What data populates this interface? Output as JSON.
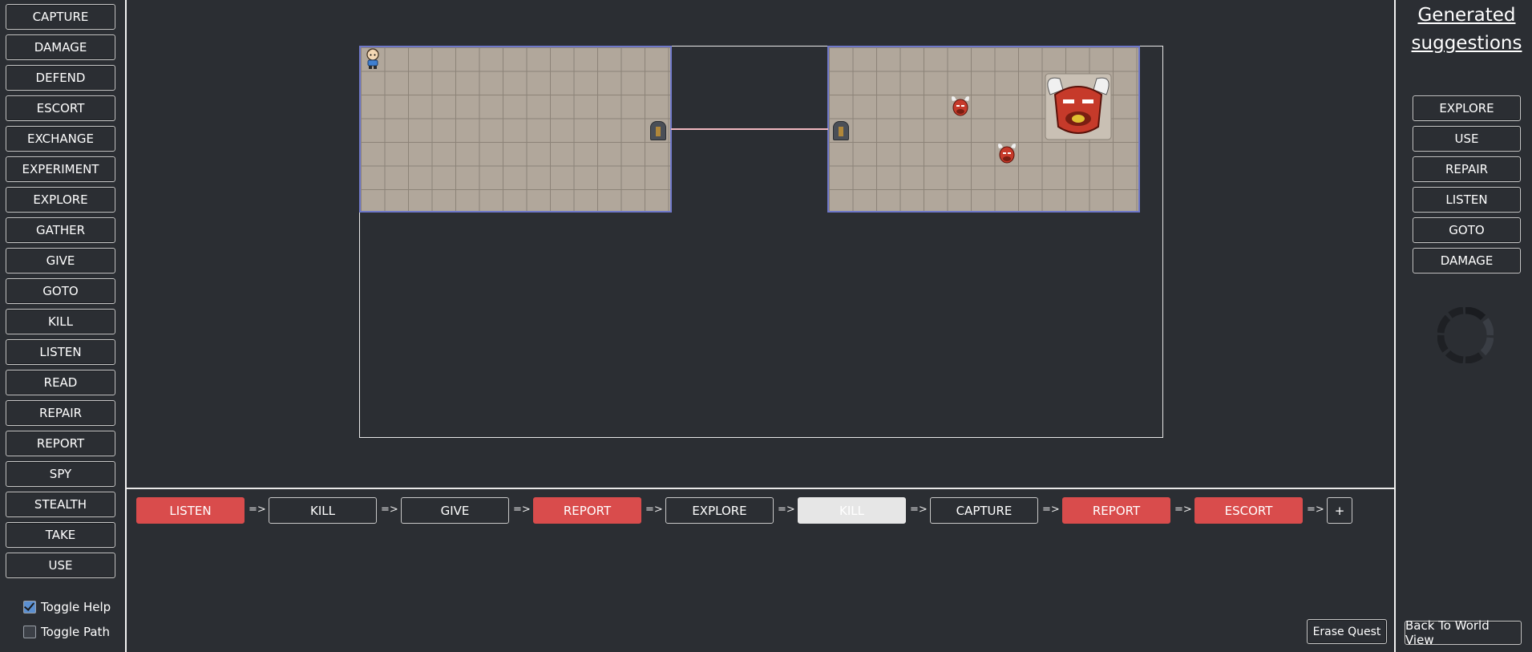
{
  "left_panel": {
    "buttons": [
      "CAPTURE",
      "DAMAGE",
      "DEFEND",
      "ESCORT",
      "EXCHANGE",
      "EXPERIMENT",
      "EXPLORE",
      "GATHER",
      "GIVE",
      "GOTO",
      "KILL",
      "LISTEN",
      "READ",
      "REPAIR",
      "REPORT",
      "SPY",
      "STEALTH",
      "TAKE",
      "USE"
    ],
    "toggle_help": {
      "label": "Toggle Help",
      "checked": true
    },
    "toggle_path": {
      "label": "Toggle Path",
      "checked": false
    }
  },
  "right_panel": {
    "title_line1": "Generated",
    "title_line2": "suggestions",
    "suggestions": [
      "EXPLORE",
      "USE",
      "REPAIR",
      "LISTEN",
      "GOTO",
      "DAMAGE"
    ],
    "back_button": "Back To World View"
  },
  "quest": {
    "steps": [
      {
        "label": "LISTEN",
        "state": "red"
      },
      {
        "label": "KILL",
        "state": "normal"
      },
      {
        "label": "GIVE",
        "state": "normal"
      },
      {
        "label": "REPORT",
        "state": "red"
      },
      {
        "label": "EXPLORE",
        "state": "normal"
      },
      {
        "label": "KILL",
        "state": "selected"
      },
      {
        "label": "CAPTURE",
        "state": "normal"
      },
      {
        "label": "REPORT",
        "state": "red"
      },
      {
        "label": "ESCORT",
        "state": "red"
      }
    ],
    "arrow": "=>",
    "add_label": "+",
    "erase_label": "Erase Quest"
  },
  "colors": {
    "background": "#2b2e33",
    "red_step": "#d94c4c",
    "room_border": "#6f78c9",
    "connector": "#f2b8c0"
  }
}
